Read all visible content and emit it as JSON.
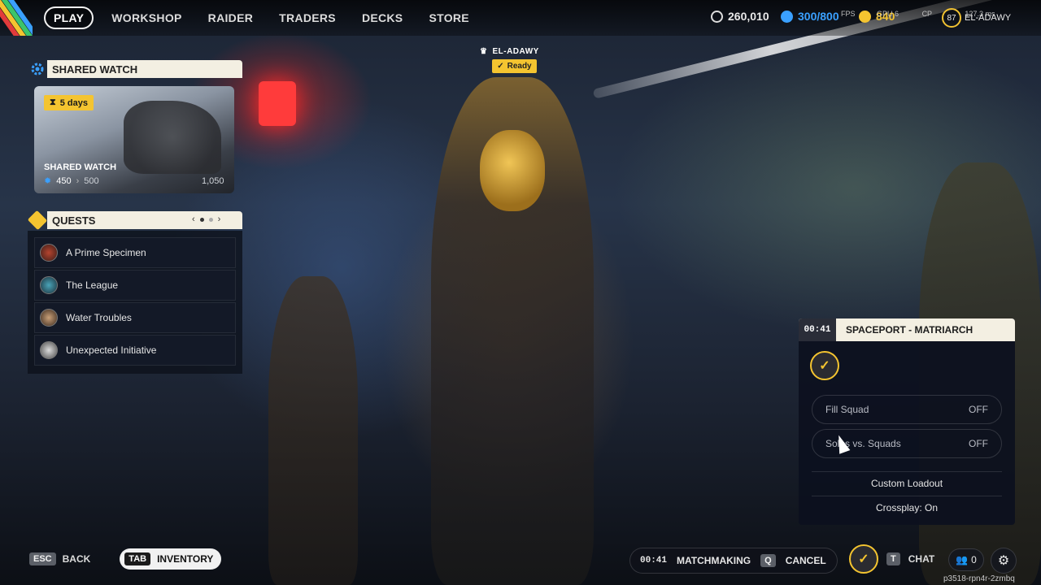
{
  "topbar": {
    "nav": [
      {
        "label": "PLAY",
        "active": true
      },
      {
        "label": "WORKSHOP"
      },
      {
        "label": "RAIDER"
      },
      {
        "label": "TRADERS"
      },
      {
        "label": "DECKS"
      },
      {
        "label": "STORE"
      }
    ],
    "coins": "260,010",
    "premium": "300/800",
    "gold": "840",
    "perf_fps": "FPS",
    "perf_gpu": "GPU 6",
    "perf_cpu": "CP",
    "perf_ms": "127.3 ms",
    "level": "87",
    "username": "EL-ADAWY",
    "colors": {
      "coin": "#f4c430",
      "premium": "#3aa0ff",
      "gold": "#f4c430"
    }
  },
  "shared_watch": {
    "header": "SHARED WATCH",
    "badge": "5 days",
    "title": "SHARED WATCH",
    "progress": "450",
    "next": "500",
    "max": "1,050"
  },
  "quests": {
    "header": "QUESTS",
    "items": [
      {
        "label": "A Prime Specimen"
      },
      {
        "label": "The League"
      },
      {
        "label": "Water Troubles"
      },
      {
        "label": "Unexpected Initiative"
      }
    ]
  },
  "player": {
    "name": "EL-ADAWY",
    "status": "Ready"
  },
  "matchmaking_panel": {
    "timer": "00:41",
    "title": "SPACEPORT - MATRIARCH",
    "fill_squad_label": "Fill Squad",
    "fill_squad_value": "OFF",
    "solos_label": "Solos vs. Squads",
    "solos_value": "OFF",
    "custom_loadout": "Custom Loadout",
    "crossplay": "Crossplay: On"
  },
  "bottom": {
    "back_key": "ESC",
    "back_label": "BACK",
    "inv_key": "TAB",
    "inv_label": "INVENTORY",
    "mm_timer": "00:41",
    "mm_label": "MATCHMAKING",
    "cancel_key": "Q",
    "cancel_label": "CANCEL",
    "chat_key": "T",
    "chat_label": "CHAT",
    "friends_count": "0",
    "session_id": "p3518-rpn4r-2zmbq"
  }
}
